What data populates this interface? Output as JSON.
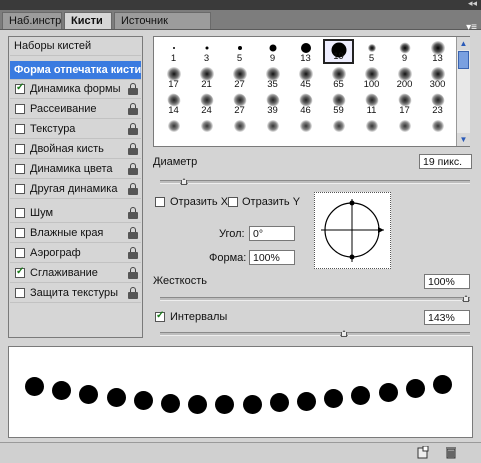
{
  "tabs": {
    "tools": "Наб.инстр",
    "brushes": "Кисти",
    "clone": "Источник клонов"
  },
  "panel_menu": "▾≡",
  "collapse_glyph": "◂◂",
  "left_list": {
    "presets": "Наборы кистей",
    "tip_shape": "Форма отпечатка кисти",
    "items": [
      {
        "label": "Динамика формы",
        "checked": true
      },
      {
        "label": "Рассеивание",
        "checked": false
      },
      {
        "label": "Текстура",
        "checked": false
      },
      {
        "label": "Двойная кисть",
        "checked": false
      },
      {
        "label": "Динамика цвета",
        "checked": false
      },
      {
        "label": "Другая динамика",
        "checked": false
      },
      {
        "label": "Шум",
        "checked": false
      },
      {
        "label": "Влажные края",
        "checked": false
      },
      {
        "label": "Аэрограф",
        "checked": false
      },
      {
        "label": "Сглаживание",
        "checked": true
      },
      {
        "label": "Защита текстуры",
        "checked": false
      }
    ]
  },
  "brush_grid": {
    "rows": [
      [
        "1",
        "3",
        "5",
        "9",
        "13",
        "19",
        "5",
        "9",
        "13"
      ],
      [
        "17",
        "21",
        "27",
        "35",
        "45",
        "65",
        "100",
        "200",
        "300"
      ],
      [
        "14",
        "24",
        "27",
        "39",
        "46",
        "59",
        "11",
        "17",
        "23"
      ]
    ],
    "selected": "19"
  },
  "diameter": {
    "label": "Диаметр",
    "value": "19 пикс.",
    "level": 0.08
  },
  "flip_x": {
    "label": "Отразить X",
    "checked": false
  },
  "flip_y": {
    "label": "Отразить Y",
    "checked": false
  },
  "angle": {
    "label": "Угол:",
    "value": "0°"
  },
  "roundness": {
    "label": "Форма:",
    "value": "100%"
  },
  "hardness": {
    "label": "Жесткость",
    "value": "100%",
    "level": 1.0
  },
  "spacing": {
    "label": "Интервалы",
    "value": "143%",
    "checked": true,
    "level": 0.6
  },
  "preview_stroke": [
    [
      0.0,
      0.0
    ],
    [
      1,
      1
    ]
  ]
}
